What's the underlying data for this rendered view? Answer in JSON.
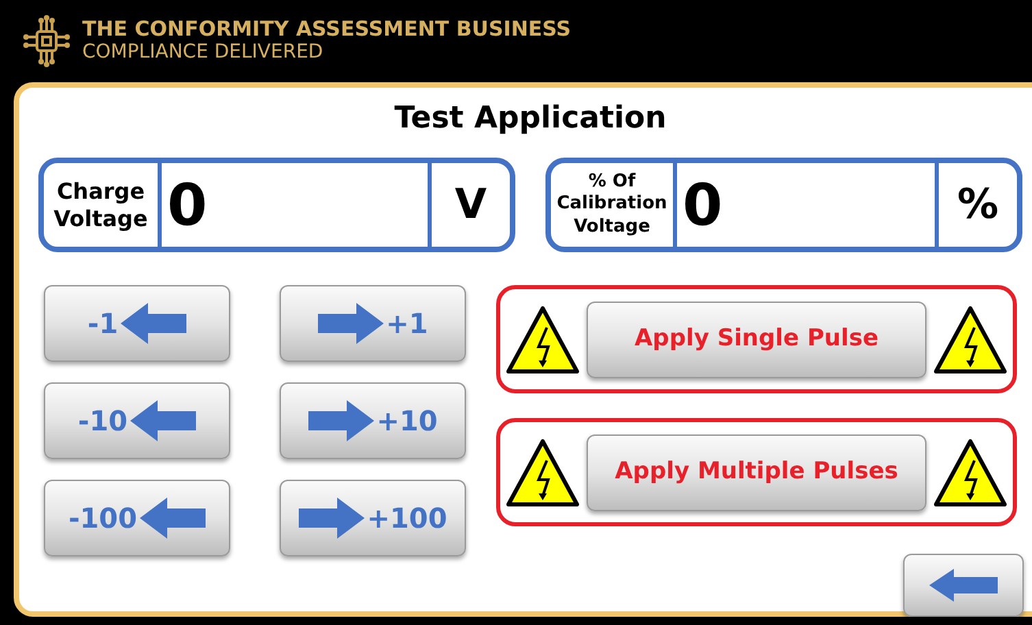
{
  "header": {
    "title": "THE CONFORMITY ASSESSMENT BUSINESS",
    "subtitle": "COMPLIANCE DELIVERED"
  },
  "title": "Test Application",
  "readouts": [
    {
      "label": "Charge Voltage",
      "value": "0",
      "unit": "V"
    },
    {
      "label": "% Of Calibration Voltage",
      "value": "0",
      "unit": "%"
    }
  ],
  "step_buttons": [
    {
      "label": "-1",
      "kind": "decrease"
    },
    {
      "label": "+1",
      "kind": "increase"
    },
    {
      "label": "-10",
      "kind": "decrease"
    },
    {
      "label": "+10",
      "kind": "increase"
    },
    {
      "label": "-100",
      "kind": "decrease"
    },
    {
      "label": "+100",
      "kind": "increase"
    }
  ],
  "pulse_buttons": [
    {
      "label": "Apply Single Pulse"
    },
    {
      "label": "Apply Multiple Pulses"
    }
  ]
}
